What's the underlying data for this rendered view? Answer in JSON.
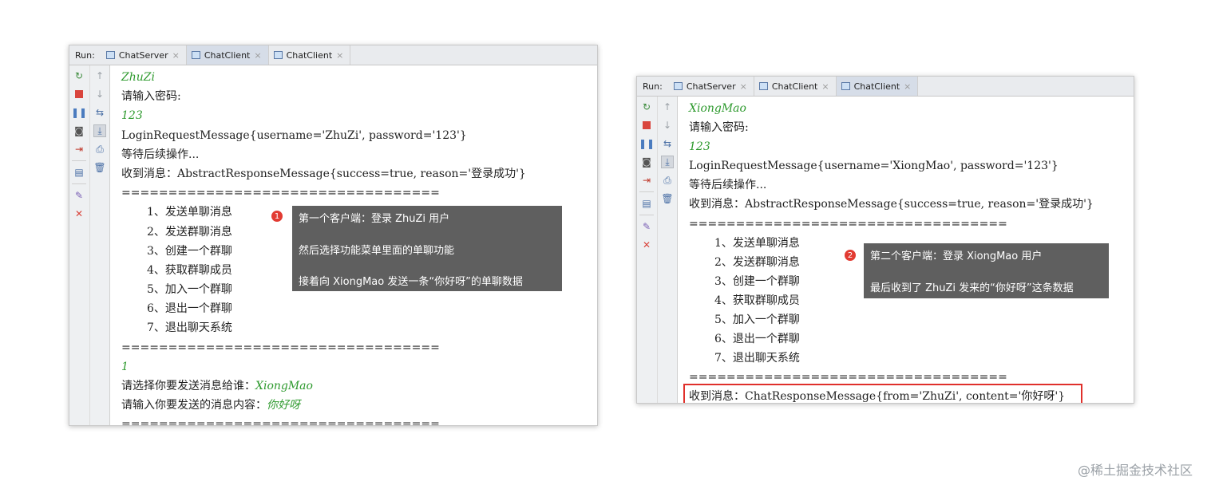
{
  "left_window": {
    "run_label": "Run:",
    "tabs": [
      {
        "label": "ChatServer",
        "close": "×"
      },
      {
        "label": "ChatClient",
        "close": "×"
      },
      {
        "label": "ChatClient",
        "close": "×"
      }
    ],
    "lines": [
      {
        "text": "ZhuZi",
        "kind": "input"
      },
      {
        "text": "请输入密码:",
        "kind": "plain"
      },
      {
        "text": "123",
        "kind": "input"
      },
      {
        "text": "LoginRequestMessage{username='ZhuZi', password='123'}",
        "kind": "plain"
      },
      {
        "text": "等待后续操作...",
        "kind": "plain"
      },
      {
        "text": "收到消息：AbstractResponseMessage{success=true, reason='登录成功'}",
        "kind": "plain"
      },
      {
        "text": "==================================",
        "kind": "plain"
      },
      {
        "text": "1、发送单聊消息",
        "kind": "menu"
      },
      {
        "text": "2、发送群聊消息",
        "kind": "menu"
      },
      {
        "text": "3、创建一个群聊",
        "kind": "menu"
      },
      {
        "text": "4、获取群聊成员",
        "kind": "menu"
      },
      {
        "text": "5、加入一个群聊",
        "kind": "menu"
      },
      {
        "text": "6、退出一个群聊",
        "kind": "menu"
      },
      {
        "text": "7、退出聊天系统",
        "kind": "menu"
      },
      {
        "text": "==================================",
        "kind": "plain"
      },
      {
        "text": "1",
        "kind": "input"
      },
      {
        "prefix": "请选择你要发送消息给谁：",
        "text": "XiongMao",
        "kind": "mixed"
      },
      {
        "prefix": "请输入你要发送的消息内容：",
        "text": "你好呀",
        "kind": "mixed"
      },
      {
        "text": "==================================",
        "kind": "plain"
      }
    ],
    "callout": {
      "badge": "1",
      "lines": [
        "第一个客户端：登录 ZhuZi 用户",
        "然后选择功能菜单里面的单聊功能",
        "接着向 XiongMao 发送一条“你好呀”的单聊数据"
      ]
    }
  },
  "right_window": {
    "run_label": "Run:",
    "tabs": [
      {
        "label": "ChatServer",
        "close": "×"
      },
      {
        "label": "ChatClient",
        "close": "×"
      },
      {
        "label": "ChatClient",
        "close": "×"
      }
    ],
    "lines": [
      {
        "text": "XiongMao",
        "kind": "input"
      },
      {
        "text": "请输入密码:",
        "kind": "plain"
      },
      {
        "text": "123",
        "kind": "input"
      },
      {
        "text": "LoginRequestMessage{username='XiongMao', password='123'}",
        "kind": "plain"
      },
      {
        "text": "等待后续操作...",
        "kind": "plain"
      },
      {
        "text": "收到消息：AbstractResponseMessage{success=true, reason='登录成功'}",
        "kind": "plain"
      },
      {
        "text": "==================================",
        "kind": "plain"
      },
      {
        "text": "1、发送单聊消息",
        "kind": "menu"
      },
      {
        "text": "2、发送群聊消息",
        "kind": "menu"
      },
      {
        "text": "3、创建一个群聊",
        "kind": "menu"
      },
      {
        "text": "4、获取群聊成员",
        "kind": "menu"
      },
      {
        "text": "5、加入一个群聊",
        "kind": "menu"
      },
      {
        "text": "6、退出一个群聊",
        "kind": "menu"
      },
      {
        "text": "7、退出聊天系统",
        "kind": "menu"
      },
      {
        "text": "==================================",
        "kind": "plain"
      },
      {
        "text": "收到消息：ChatResponseMessage{from='ZhuZi', content='你好呀'}",
        "kind": "plain"
      }
    ],
    "callout": {
      "badge": "2",
      "lines": [
        "第二个客户端：登录 XiongMao 用户",
        "最后收到了 ZhuZi 发来的“你好呀”这条数据"
      ]
    }
  },
  "watermark": "@稀土掘金技术社区",
  "colors": {
    "input_text": "#2e9a2e",
    "callout_bg": "#5f5f5f",
    "badge": "#e23b32",
    "highlight_border": "#e0302b"
  }
}
